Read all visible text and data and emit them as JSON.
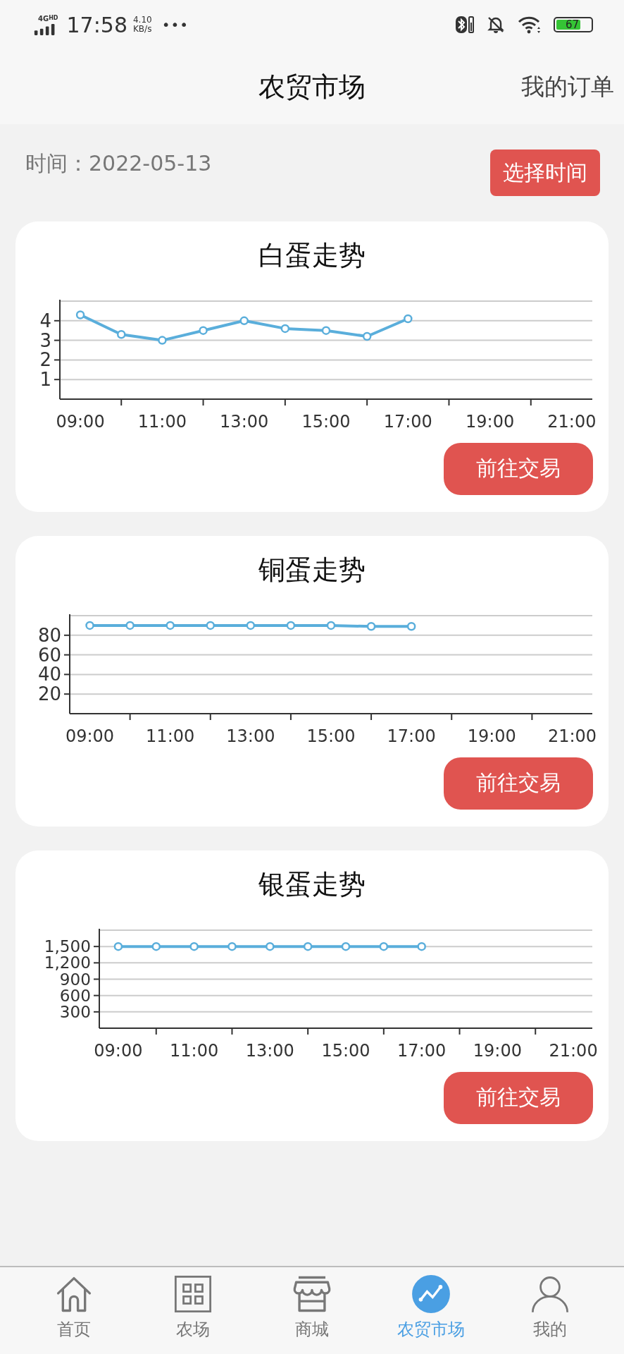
{
  "status_bar": {
    "network": "4G",
    "network_badge": "HD",
    "time": "17:58",
    "speed_value": "4.10",
    "speed_unit": "KB/s",
    "more": "•••",
    "battery": "67"
  },
  "header": {
    "title": "农贸市场",
    "action": "我的订单"
  },
  "filter": {
    "label": "时间：2022-05-13",
    "button": "选择时间"
  },
  "cards": [
    {
      "title": "白蛋走势",
      "button": "前往交易",
      "chart_data": {
        "type": "line",
        "x": [
          9,
          10,
          11,
          12,
          13,
          14,
          15,
          16,
          17
        ],
        "grid": true,
        "series": [
          {
            "color": "#5aaedb",
            "marker": true,
            "values": [
              4.3,
              3.3,
              3.0,
              3.5,
              4.0,
              3.6,
              3.5,
              3.2,
              4.1
            ]
          }
        ],
        "xlim": [
          8.5,
          21.5
        ],
        "ylim": [
          0,
          5
        ],
        "xticks": [
          {
            "value": 9,
            "label": "09:00"
          },
          {
            "value": 11,
            "label": "11:00"
          },
          {
            "value": 13,
            "label": "13:00"
          },
          {
            "value": 15,
            "label": "15:00"
          },
          {
            "value": 17,
            "label": "17:00"
          },
          {
            "value": 19,
            "label": "19:00"
          },
          {
            "value": 21,
            "label": "21:00"
          }
        ],
        "yticks": [
          1,
          2,
          3,
          4
        ]
      }
    },
    {
      "title": "铜蛋走势",
      "button": "前往交易",
      "chart_data": {
        "type": "line",
        "x": [
          9,
          10,
          11,
          12,
          13,
          14,
          15,
          16,
          17
        ],
        "grid": true,
        "series": [
          {
            "color": "#5aaedb",
            "marker": true,
            "values": [
              90,
              90,
              90,
              90,
              90,
              90,
              90,
              89,
              89
            ]
          }
        ],
        "xlim": [
          8.5,
          21.5
        ],
        "ylim": [
          0,
          100
        ],
        "xticks": [
          {
            "value": 9,
            "label": "09:00"
          },
          {
            "value": 11,
            "label": "11:00"
          },
          {
            "value": 13,
            "label": "13:00"
          },
          {
            "value": 15,
            "label": "15:00"
          },
          {
            "value": 17,
            "label": "17:00"
          },
          {
            "value": 19,
            "label": "19:00"
          },
          {
            "value": 21,
            "label": "21:00"
          }
        ],
        "yticks": [
          20,
          40,
          60,
          80
        ]
      }
    },
    {
      "title": "银蛋走势",
      "button": "前往交易",
      "chart_data": {
        "type": "line",
        "x": [
          9,
          10,
          11,
          12,
          13,
          14,
          15,
          16,
          17
        ],
        "grid": true,
        "series": [
          {
            "color": "#5aaedb",
            "marker": true,
            "values": [
              1500,
              1500,
              1500,
              1500,
              1500,
              1500,
              1500,
              1500,
              1500
            ]
          }
        ],
        "xlim": [
          8.5,
          21.5
        ],
        "ylim": [
          0,
          1800
        ],
        "xticks": [
          {
            "value": 9,
            "label": "09:00"
          },
          {
            "value": 11,
            "label": "11:00"
          },
          {
            "value": 13,
            "label": "13:00"
          },
          {
            "value": 15,
            "label": "15:00"
          },
          {
            "value": 17,
            "label": "17:00"
          },
          {
            "value": 19,
            "label": "19:00"
          },
          {
            "value": 21,
            "label": "21:00"
          }
        ],
        "yticks": [
          {
            "value": 300,
            "label": "300"
          },
          {
            "value": 600,
            "label": "600"
          },
          {
            "value": 900,
            "label": "900"
          },
          {
            "value": 1200,
            "label": "1,200"
          },
          {
            "value": 1500,
            "label": "1,500"
          }
        ]
      }
    }
  ],
  "nav": [
    {
      "kind": "home",
      "label": "首页",
      "selected": false
    },
    {
      "kind": "farm",
      "label": "农场",
      "selected": false
    },
    {
      "kind": "shop",
      "label": "商城",
      "selected": false
    },
    {
      "kind": "market",
      "label": "农贸市场",
      "selected": true
    },
    {
      "kind": "profile",
      "label": "我的",
      "selected": false
    }
  ]
}
